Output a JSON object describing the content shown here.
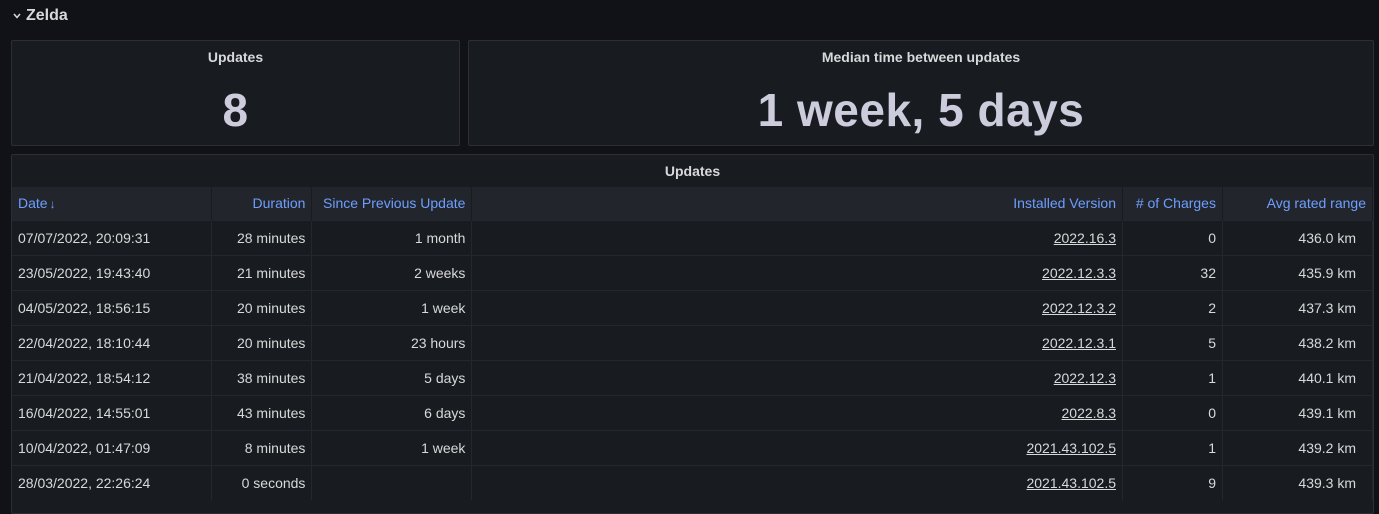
{
  "row": {
    "title": "Zelda",
    "chevron_icon": "chevron-down-icon"
  },
  "stats": [
    {
      "title": "Updates",
      "value": "8"
    },
    {
      "title": "Median time between updates",
      "value": "1 week, 5 days"
    }
  ],
  "table": {
    "title": "Updates",
    "headers": {
      "date": "Date",
      "sort_icon": "↓",
      "duration": "Duration",
      "since_previous": "Since Previous Update",
      "installed_version": "Installed Version",
      "charges": "# of Charges",
      "avg_range": "Avg rated range"
    },
    "rows": [
      {
        "date": "07/07/2022, 20:09:31",
        "duration": "28 minutes",
        "since": "1 month",
        "version": "2022.16.3",
        "charges": "0",
        "range": "436.0 km"
      },
      {
        "date": "23/05/2022, 19:43:40",
        "duration": "21 minutes",
        "since": "2 weeks",
        "version": "2022.12.3.3",
        "charges": "32",
        "range": "435.9 km"
      },
      {
        "date": "04/05/2022, 18:56:15",
        "duration": "20 minutes",
        "since": "1 week",
        "version": "2022.12.3.2",
        "charges": "2",
        "range": "437.3 km"
      },
      {
        "date": "22/04/2022, 18:10:44",
        "duration": "20 minutes",
        "since": "23 hours",
        "version": "2022.12.3.1",
        "charges": "5",
        "range": "438.2 km"
      },
      {
        "date": "21/04/2022, 18:54:12",
        "duration": "38 minutes",
        "since": "5 days",
        "version": "2022.12.3",
        "charges": "1",
        "range": "440.1 km"
      },
      {
        "date": "16/04/2022, 14:55:01",
        "duration": "43 minutes",
        "since": "6 days",
        "version": "2022.8.3",
        "charges": "0",
        "range": "439.1 km"
      },
      {
        "date": "10/04/2022, 01:47:09",
        "duration": "8 minutes",
        "since": "1 week",
        "version": "2021.43.102.5",
        "charges": "1",
        "range": "439.2 km"
      },
      {
        "date": "28/03/2022, 22:26:24",
        "duration": "0 seconds",
        "since": "",
        "version": "2021.43.102.5",
        "charges": "9",
        "range": "439.3 km"
      }
    ]
  },
  "colors": {
    "background": "#111217",
    "panel": "#181b1f",
    "header_link": "#6e9fff",
    "text": "#d8d9da"
  }
}
